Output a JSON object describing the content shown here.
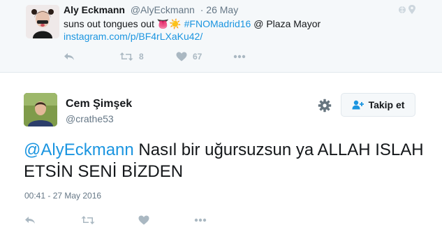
{
  "top_tweet": {
    "name": "Aly Eckmann",
    "handle": "@AlyEckmann",
    "date": "· 26 May",
    "text_before": "suns out tongues out ",
    "emoji": "👅☀️",
    "hashtag": "#FNOMadrid16",
    "text_after": " @ Plaza Mayor",
    "link": "instagram.com/p/BF4rLXaKu42/",
    "retweet_count": "8",
    "like_count": "67"
  },
  "main_tweet": {
    "name": "Cem Şimşek",
    "handle": "@crathe53",
    "follow_label": "Takip et",
    "mention": "@AlyEckmann",
    "text_rest": " Nasıl bir uğursuzsun ya ALLAH ISLAH ETSİN SENİ BİZDEN",
    "timestamp": "00:41 - 27 May 2016"
  },
  "colors": {
    "link": "#1b95e0",
    "icon": "#aab8c2",
    "muted": "#657786"
  }
}
